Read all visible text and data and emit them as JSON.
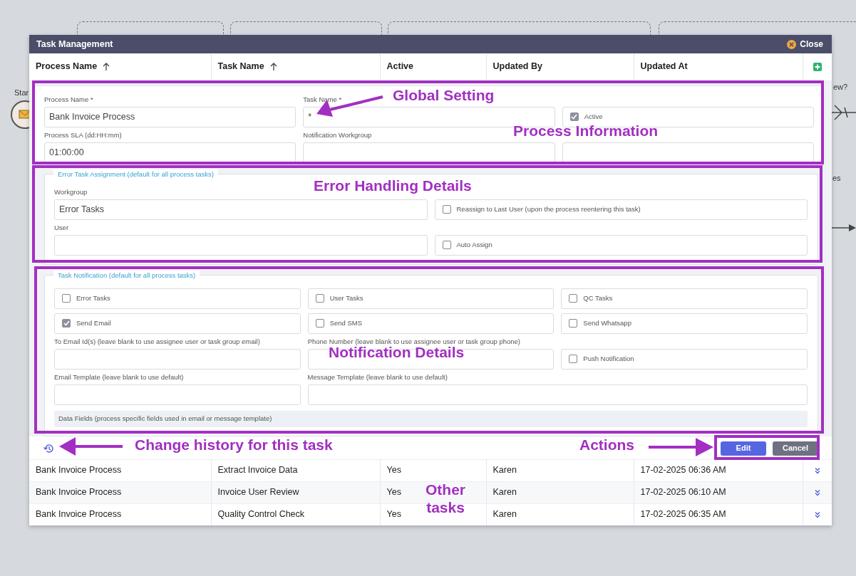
{
  "background": {
    "labels": [
      {
        "text": "Star",
        "kind": "side"
      },
      {
        "text": "ew?",
        "kind": "side"
      },
      {
        "text": "es",
        "kind": "side"
      }
    ]
  },
  "modal": {
    "title": "Task Management",
    "close_label": "Close"
  },
  "table": {
    "columns": [
      {
        "label": "Process Name",
        "sorted": true
      },
      {
        "label": "Task Name",
        "sorted": true
      },
      {
        "label": "Active",
        "sorted": false
      },
      {
        "label": "Updated By",
        "sorted": false
      },
      {
        "label": "Updated At",
        "sorted": false
      }
    ],
    "rows": [
      {
        "process": "Bank Invoice Process",
        "task": "Extract Invoice Data",
        "active": "Yes",
        "updated_by": "Karen",
        "updated_at": "17-02-2025 06:36 AM"
      },
      {
        "process": "Bank Invoice Process",
        "task": "Invoice User Review",
        "active": "Yes",
        "updated_by": "Karen",
        "updated_at": "17-02-2025 06:10 AM"
      },
      {
        "process": "Bank Invoice Process",
        "task": "Quality Control Check",
        "active": "Yes",
        "updated_by": "Karen",
        "updated_at": "17-02-2025 06:35 AM"
      }
    ]
  },
  "form": {
    "global": {
      "fields": [
        {
          "kind": "text",
          "label": "Process Name *",
          "value": "Bank Invoice Process"
        },
        {
          "kind": "text",
          "label": "Task Name *",
          "value": "*"
        },
        {
          "kind": "checkbox",
          "label": "Active",
          "checked": true
        },
        {
          "kind": "text",
          "label": "Process SLA (dd:HH:mm)",
          "value": "01:00:00"
        },
        {
          "kind": "text",
          "label": "Notification Workgroup"
        },
        {
          "kind": "text"
        }
      ]
    },
    "error_assignment": {
      "legend": "Error Task Assignment (default for all process tasks)",
      "fields": [
        {
          "kind": "text",
          "label": "Workgroup",
          "value": "Error Tasks"
        },
        {
          "kind": "checkbox",
          "label": "Reassign to Last User (upon the process reentering this task)",
          "checked": false
        },
        {
          "kind": "text",
          "label": "User"
        },
        {
          "kind": "checkbox",
          "label": "Auto Assign",
          "checked": false
        }
      ]
    },
    "notification": {
      "legend": "Task Notification (default for all process tasks)",
      "options": [
        {
          "label": "Error Tasks",
          "checked": false
        },
        {
          "label": "User Tasks",
          "checked": false
        },
        {
          "label": "QC Tasks",
          "checked": false
        },
        {
          "label": "Send Email",
          "checked": true
        },
        {
          "label": "Send SMS",
          "checked": false
        },
        {
          "label": "Send Whatsapp",
          "checked": false
        }
      ],
      "recipient_fields": [
        {
          "kind": "text",
          "label": "To Email Id(s) (leave blank to use assignee user or task group email)"
        },
        {
          "kind": "text",
          "label": "Phone Number (leave blank to use assignee user or task group phone)"
        },
        {
          "kind": "checkbox",
          "label": "Push Notification",
          "checked": false
        }
      ],
      "template_fields": [
        {
          "kind": "text",
          "label": "Email Template (leave blank to use default)"
        },
        {
          "kind": "text",
          "label": "Message Template (leave blank to use default)"
        }
      ],
      "data_fields": "Data Fields (process specific fields used in email or message template)"
    },
    "actions": [
      {
        "label": "Edit",
        "kind": "primary"
      },
      {
        "label": "Cancel",
        "kind": "secondary"
      }
    ]
  },
  "annotations": [
    {
      "text": "Global Setting"
    },
    {
      "text": "Process Information"
    },
    {
      "text": "Error Handling Details"
    },
    {
      "text": "Notification Details"
    },
    {
      "text": "Change history for this task"
    },
    {
      "text": "Actions"
    },
    {
      "text": "Other tasks"
    }
  ]
}
